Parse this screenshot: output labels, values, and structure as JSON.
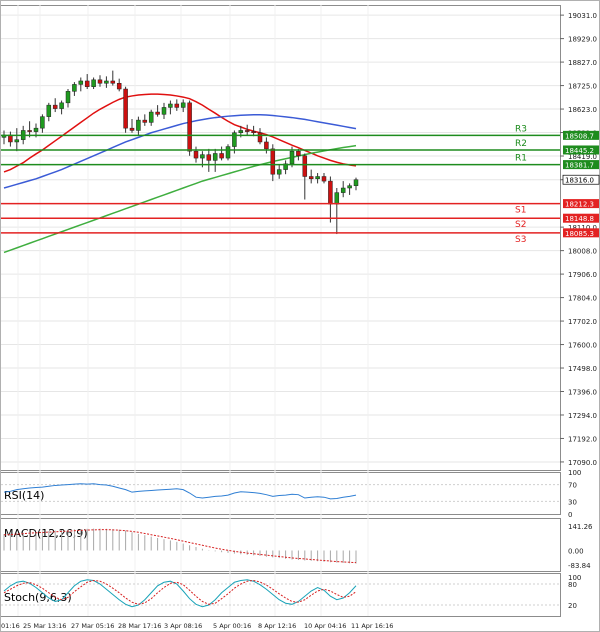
{
  "chart_data": {
    "type": "candlestick",
    "title": "",
    "price_axis": {
      "ylim": [
        17055,
        19075
      ],
      "tick_labels": [
        "19031.0",
        "18929.0",
        "18827.0",
        "18725.0",
        "18623.0",
        "18521.0",
        "18419.0",
        "18316.0",
        "18110.0",
        "18008.0",
        "17906.0",
        "17804.0",
        "17702.0",
        "17600.0",
        "17498.0",
        "17396.0",
        "17294.0",
        "17192.0",
        "17090.0"
      ],
      "grid": true
    },
    "x_axis": {
      "tick_labels": [
        "01:16",
        "25 Mar 13:16",
        "27 Mar 05:16",
        "28 Mar 17:16",
        "3 Apr 08:16",
        "5 Apr 00:16",
        "8 Apr 12:16",
        "10 Apr 04:16",
        "11 Apr 16:16"
      ]
    },
    "levels": [
      {
        "name": "R3",
        "value": 18508.7,
        "label": "18508.7",
        "color": "#1e8c1e"
      },
      {
        "name": "R2",
        "value": 18445.2,
        "label": "18445.2",
        "color": "#1e8c1e"
      },
      {
        "name": "R1",
        "value": 18381.7,
        "label": "18381.7",
        "color": "#1e8c1e"
      },
      {
        "name": "S1",
        "value": 18212.3,
        "label": "18212.3",
        "color": "#e32222"
      },
      {
        "name": "S2",
        "value": 18148.8,
        "label": "18148.8",
        "color": "#e32222"
      },
      {
        "name": "S3",
        "value": 18085.3,
        "label": "18085.3",
        "color": "#e32222"
      }
    ],
    "current_price": "18316.0",
    "candles": [
      {
        "o": 18500,
        "h": 18530,
        "l": 18470,
        "c": 18510
      },
      {
        "o": 18510,
        "h": 18525,
        "l": 18460,
        "c": 18480
      },
      {
        "o": 18480,
        "h": 18540,
        "l": 18440,
        "c": 18490
      },
      {
        "o": 18490,
        "h": 18550,
        "l": 18470,
        "c": 18530
      },
      {
        "o": 18530,
        "h": 18570,
        "l": 18500,
        "c": 18525
      },
      {
        "o": 18525,
        "h": 18560,
        "l": 18500,
        "c": 18540
      },
      {
        "o": 18540,
        "h": 18600,
        "l": 18520,
        "c": 18590
      },
      {
        "o": 18590,
        "h": 18650,
        "l": 18570,
        "c": 18640
      },
      {
        "o": 18640,
        "h": 18670,
        "l": 18610,
        "c": 18625
      },
      {
        "o": 18625,
        "h": 18660,
        "l": 18600,
        "c": 18650
      },
      {
        "o": 18650,
        "h": 18710,
        "l": 18630,
        "c": 18700
      },
      {
        "o": 18700,
        "h": 18740,
        "l": 18680,
        "c": 18730
      },
      {
        "o": 18730,
        "h": 18760,
        "l": 18700,
        "c": 18745
      },
      {
        "o": 18745,
        "h": 18775,
        "l": 18710,
        "c": 18720
      },
      {
        "o": 18720,
        "h": 18760,
        "l": 18710,
        "c": 18750
      },
      {
        "o": 18750,
        "h": 18770,
        "l": 18720,
        "c": 18735
      },
      {
        "o": 18735,
        "h": 18765,
        "l": 18715,
        "c": 18745
      },
      {
        "o": 18745,
        "h": 18790,
        "l": 18725,
        "c": 18735
      },
      {
        "o": 18735,
        "h": 18755,
        "l": 18700,
        "c": 18710
      },
      {
        "o": 18710,
        "h": 18720,
        "l": 18520,
        "c": 18540
      },
      {
        "o": 18540,
        "h": 18580,
        "l": 18520,
        "c": 18530
      },
      {
        "o": 18530,
        "h": 18590,
        "l": 18510,
        "c": 18575
      },
      {
        "o": 18575,
        "h": 18600,
        "l": 18550,
        "c": 18565
      },
      {
        "o": 18565,
        "h": 18620,
        "l": 18550,
        "c": 18610
      },
      {
        "o": 18610,
        "h": 18640,
        "l": 18590,
        "c": 18600
      },
      {
        "o": 18600,
        "h": 18650,
        "l": 18580,
        "c": 18630
      },
      {
        "o": 18630,
        "h": 18660,
        "l": 18600,
        "c": 18645
      },
      {
        "o": 18645,
        "h": 18665,
        "l": 18615,
        "c": 18630
      },
      {
        "o": 18630,
        "h": 18665,
        "l": 18610,
        "c": 18650
      },
      {
        "o": 18650,
        "h": 18660,
        "l": 18420,
        "c": 18440
      },
      {
        "o": 18440,
        "h": 18460,
        "l": 18390,
        "c": 18410
      },
      {
        "o": 18410,
        "h": 18440,
        "l": 18370,
        "c": 18425
      },
      {
        "o": 18425,
        "h": 18450,
        "l": 18350,
        "c": 18400
      },
      {
        "o": 18400,
        "h": 18450,
        "l": 18350,
        "c": 18430
      },
      {
        "o": 18430,
        "h": 18460,
        "l": 18400,
        "c": 18410
      },
      {
        "o": 18410,
        "h": 18470,
        "l": 18400,
        "c": 18460
      },
      {
        "o": 18460,
        "h": 18530,
        "l": 18430,
        "c": 18520
      },
      {
        "o": 18520,
        "h": 18550,
        "l": 18500,
        "c": 18530
      },
      {
        "o": 18530,
        "h": 18555,
        "l": 18510,
        "c": 18525
      },
      {
        "o": 18525,
        "h": 18550,
        "l": 18505,
        "c": 18520
      },
      {
        "o": 18520,
        "h": 18540,
        "l": 18470,
        "c": 18480
      },
      {
        "o": 18480,
        "h": 18500,
        "l": 18430,
        "c": 18450
      },
      {
        "o": 18450,
        "h": 18470,
        "l": 18310,
        "c": 18340
      },
      {
        "o": 18340,
        "h": 18380,
        "l": 18320,
        "c": 18360
      },
      {
        "o": 18360,
        "h": 18400,
        "l": 18340,
        "c": 18385
      },
      {
        "o": 18385,
        "h": 18460,
        "l": 18370,
        "c": 18440
      },
      {
        "o": 18440,
        "h": 18450,
        "l": 18400,
        "c": 18420
      },
      {
        "o": 18420,
        "h": 18430,
        "l": 18230,
        "c": 18330
      },
      {
        "o": 18330,
        "h": 18360,
        "l": 18300,
        "c": 18320
      },
      {
        "o": 18320,
        "h": 18345,
        "l": 18300,
        "c": 18330
      },
      {
        "o": 18330,
        "h": 18345,
        "l": 18300,
        "c": 18310
      },
      {
        "o": 18310,
        "h": 18330,
        "l": 18130,
        "c": 18210
      },
      {
        "o": 18210,
        "h": 18280,
        "l": 18080,
        "c": 18260
      },
      {
        "o": 18260,
        "h": 18310,
        "l": 18240,
        "c": 18280
      },
      {
        "o": 18280,
        "h": 18300,
        "l": 18250,
        "c": 18290
      },
      {
        "o": 18290,
        "h": 18325,
        "l": 18270,
        "c": 18316
      }
    ],
    "moving_averages": [
      {
        "name": "MA (short)",
        "color": "#e01010",
        "values": [
          18350,
          18360,
          18375,
          18390,
          18410,
          18428,
          18445,
          18465,
          18485,
          18505,
          18525,
          18545,
          18565,
          18585,
          18605,
          18622,
          18637,
          18652,
          18665,
          18675,
          18680,
          18684,
          18686,
          18688,
          18688,
          18686,
          18684,
          18680,
          18675,
          18668,
          18655,
          18640,
          18622,
          18605,
          18587,
          18570,
          18555,
          18545,
          18535,
          18527,
          18520,
          18512,
          18502,
          18490,
          18478,
          18466,
          18455,
          18443,
          18432,
          18420,
          18410,
          18400,
          18392,
          18385,
          18380,
          18376
        ]
      },
      {
        "name": "MA (medium)",
        "color": "#3b5bd6",
        "values": [
          18280,
          18288,
          18296,
          18304,
          18312,
          18320,
          18330,
          18340,
          18350,
          18360,
          18372,
          18384,
          18396,
          18408,
          18420,
          18432,
          18444,
          18456,
          18468,
          18480,
          18490,
          18500,
          18510,
          18520,
          18528,
          18536,
          18544,
          18552,
          18560,
          18566,
          18572,
          18577,
          18582,
          18586,
          18589,
          18592,
          18594,
          18596,
          18597,
          18598,
          18598,
          18597,
          18595,
          18592,
          18589,
          18586,
          18582,
          18578,
          18573,
          18568,
          18563,
          18558,
          18553,
          18548,
          18543,
          18538
        ]
      },
      {
        "name": "MA (long)",
        "color": "#3fae3f",
        "values": [
          18000,
          18010,
          18020,
          18030,
          18040,
          18050,
          18060,
          18070,
          18080,
          18090,
          18100,
          18110,
          18120,
          18130,
          18140,
          18150,
          18160,
          18170,
          18180,
          18190,
          18200,
          18210,
          18220,
          18230,
          18240,
          18250,
          18260,
          18270,
          18280,
          18290,
          18300,
          18310,
          18318,
          18326,
          18334,
          18342,
          18350,
          18358,
          18366,
          18374,
          18381,
          18388,
          18395,
          18401,
          18407,
          18413,
          18419,
          18425,
          18431,
          18436,
          18441,
          18446,
          18451,
          18456,
          18460,
          18464
        ]
      }
    ],
    "rsi": {
      "label": "RSI(14)",
      "ticks": [
        "100",
        "70",
        "30",
        "0"
      ],
      "values": [
        52,
        54,
        58,
        60,
        62,
        63,
        64,
        66,
        68,
        69,
        70,
        71,
        72,
        71,
        72,
        70,
        69,
        66,
        62,
        58,
        52,
        54,
        55,
        56,
        57,
        58,
        59,
        60,
        58,
        50,
        40,
        38,
        40,
        42,
        43,
        45,
        50,
        53,
        52,
        51,
        49,
        46,
        42,
        44,
        45,
        47,
        46,
        38,
        40,
        41,
        40,
        36,
        37,
        40,
        42,
        45
      ]
    },
    "macd": {
      "label": "MACD(12,26,9)",
      "ticks": [
        "141.26",
        "0.00",
        "-83.84"
      ],
      "histogram": [
        95,
        98,
        100,
        102,
        105,
        108,
        110,
        112,
        115,
        118,
        120,
        122,
        124,
        125,
        126,
        126,
        125,
        123,
        120,
        115,
        105,
        96,
        88,
        80,
        72,
        65,
        58,
        50,
        40,
        30,
        20,
        10,
        2,
        -5,
        -10,
        -14,
        -18,
        -22,
        -25,
        -28,
        -32,
        -36,
        -40,
        -44,
        -48,
        -52,
        -55,
        -58,
        -60,
        -62,
        -65,
        -68,
        -70,
        -72,
        -74,
        -75
      ],
      "signal": [
        90,
        92,
        95,
        97,
        100,
        102,
        104,
        106,
        108,
        110,
        112,
        114,
        116,
        118,
        119,
        120,
        120,
        119,
        117,
        114,
        110,
        105,
        98,
        91,
        84,
        77,
        70,
        62,
        54,
        46,
        38,
        30,
        22,
        14,
        7,
        1,
        -5,
        -10,
        -15,
        -19,
        -23,
        -27,
        -31,
        -35,
        -39,
        -43,
        -46,
        -49,
        -52,
        -55,
        -58,
        -61,
        -64,
        -66,
        -68,
        -70
      ]
    },
    "stoch": {
      "label": "Stoch(9,6,3)",
      "ticks": [
        "100",
        "80",
        "20"
      ],
      "k": [
        60,
        75,
        85,
        88,
        82,
        70,
        55,
        40,
        30,
        35,
        55,
        75,
        88,
        92,
        90,
        80,
        65,
        50,
        35,
        22,
        15,
        20,
        35,
        55,
        75,
        85,
        88,
        80,
        60,
        38,
        22,
        15,
        20,
        35,
        55,
        70,
        85,
        90,
        92,
        88,
        78,
        65,
        50,
        35,
        25,
        22,
        30,
        45,
        60,
        70,
        62,
        45,
        35,
        40,
        55,
        75
      ],
      "d": [
        55,
        65,
        75,
        82,
        84,
        78,
        68,
        55,
        42,
        35,
        42,
        58,
        72,
        85,
        90,
        88,
        80,
        68,
        55,
        40,
        28,
        22,
        26,
        38,
        55,
        70,
        82,
        85,
        78,
        62,
        45,
        30,
        22,
        25,
        38,
        52,
        68,
        80,
        88,
        90,
        86,
        77,
        65,
        52,
        40,
        30,
        28,
        35,
        48,
        60,
        65,
        60,
        50,
        42,
        45,
        58
      ]
    }
  }
}
